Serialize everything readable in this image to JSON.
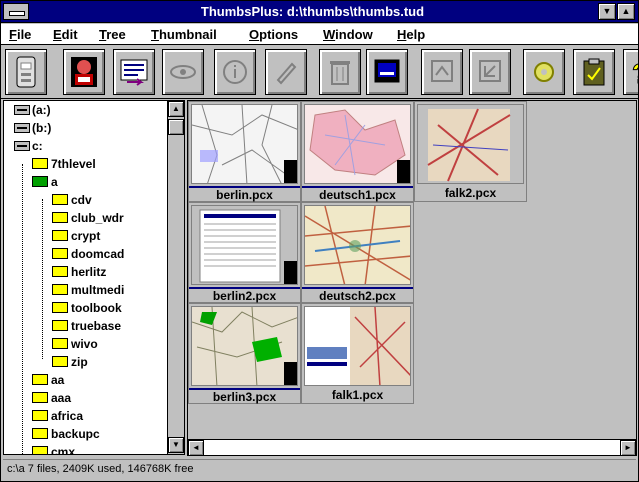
{
  "window": {
    "title": "ThumbsPlus: d:\\thumbs\\thumbs.tud"
  },
  "menu": [
    "File",
    "Edit",
    "Tree",
    "Thumbnail",
    "Options",
    "Window",
    "Help"
  ],
  "toolbar": {
    "tools": [
      {
        "icon": "scanner-icon",
        "enabled": true
      },
      {
        "icon": "viewer-face-icon",
        "enabled": true
      },
      {
        "icon": "catalog-list-icon",
        "enabled": true
      },
      {
        "icon": "eye-icon",
        "enabled": false
      },
      {
        "icon": "info-icon",
        "enabled": false
      },
      {
        "icon": "pencil-icon",
        "enabled": false
      },
      {
        "icon": "trash-icon",
        "enabled": false
      },
      {
        "icon": "monitor-icon",
        "enabled": true
      },
      {
        "icon": "move-icon",
        "enabled": false
      },
      {
        "icon": "copy-icon",
        "enabled": false
      },
      {
        "icon": "gear-icon",
        "enabled": true
      },
      {
        "icon": "clipboard-icon",
        "enabled": true
      },
      {
        "icon": "help-icon",
        "enabled": true
      }
    ]
  },
  "tree": {
    "items": [
      {
        "label": "(a:)",
        "kind": "drive",
        "level": 0
      },
      {
        "label": "(b:)",
        "kind": "drive",
        "level": 0
      },
      {
        "label": "c:",
        "kind": "drive",
        "level": 0
      },
      {
        "label": "7thlevel",
        "kind": "folder",
        "level": 1
      },
      {
        "label": "a",
        "kind": "open-folder",
        "level": 1
      },
      {
        "label": "cdv",
        "kind": "folder",
        "level": 2
      },
      {
        "label": "club_wdr",
        "kind": "folder",
        "level": 2
      },
      {
        "label": "crypt",
        "kind": "folder",
        "level": 2
      },
      {
        "label": "doomcad",
        "kind": "folder",
        "level": 2
      },
      {
        "label": "herlitz",
        "kind": "folder",
        "level": 2
      },
      {
        "label": "multmedi",
        "kind": "folder",
        "level": 2
      },
      {
        "label": "toolbook",
        "kind": "folder",
        "level": 2
      },
      {
        "label": "truebase",
        "kind": "folder",
        "level": 2
      },
      {
        "label": "wivo",
        "kind": "folder",
        "level": 2
      },
      {
        "label": "zip",
        "kind": "folder",
        "level": 2
      },
      {
        "label": "aa",
        "kind": "folder",
        "level": 1
      },
      {
        "label": "aaa",
        "kind": "folder",
        "level": 1
      },
      {
        "label": "africa",
        "kind": "folder",
        "level": 1
      },
      {
        "label": "backupc",
        "kind": "folder",
        "level": 1
      },
      {
        "label": "cmx",
        "kind": "folder",
        "level": 1
      }
    ]
  },
  "thumbnails": [
    {
      "name": "berlin.pcx",
      "selected": true
    },
    {
      "name": "deutsch1.pcx",
      "selected": true
    },
    {
      "name": "falk2.pcx",
      "selected": false
    },
    {
      "name": "berlin2.pcx",
      "selected": true
    },
    {
      "name": "deutsch2.pcx",
      "selected": true
    },
    {
      "name": "berlin3.pcx",
      "selected": true
    },
    {
      "name": "falk1.pcx",
      "selected": false
    }
  ],
  "status": {
    "text": "c:\\a 7 files, 2409K used, 146768K free"
  }
}
